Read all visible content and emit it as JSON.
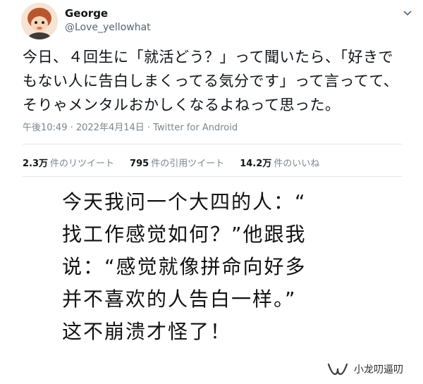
{
  "tweet": {
    "display_name": "George",
    "handle": "@Love_yellowhat",
    "text": "今日、４回生に「就活どう？」って聞いたら、「好きでもない人に告白しまくってる気分です」って言ってて、そりゃメンタルおかしくなるよねって思った。",
    "meta": "午後10:49 · 2022年4月14日 · Twitter for Android",
    "stats": [
      {
        "count": "2.3万",
        "label": "件のリツイート"
      },
      {
        "count": "795",
        "label": "件の引用ツイート"
      },
      {
        "count": "14.2万",
        "label": "件のいいね"
      }
    ]
  },
  "caption": {
    "lines": [
      "今天我问一个大四的人：“",
      "找工作感觉如何？”他跟我",
      "说：“感觉就像拼命向好多",
      "并不喜欢的人告白一样。”",
      "这不崩溃才怪了！"
    ]
  },
  "watermark": {
    "text": "小龙叨逼叨"
  },
  "icons": {
    "avatar": "cartoon-avatar-icon",
    "menu": "chevron-down-icon",
    "watermark": "wechat-channel-icon"
  }
}
